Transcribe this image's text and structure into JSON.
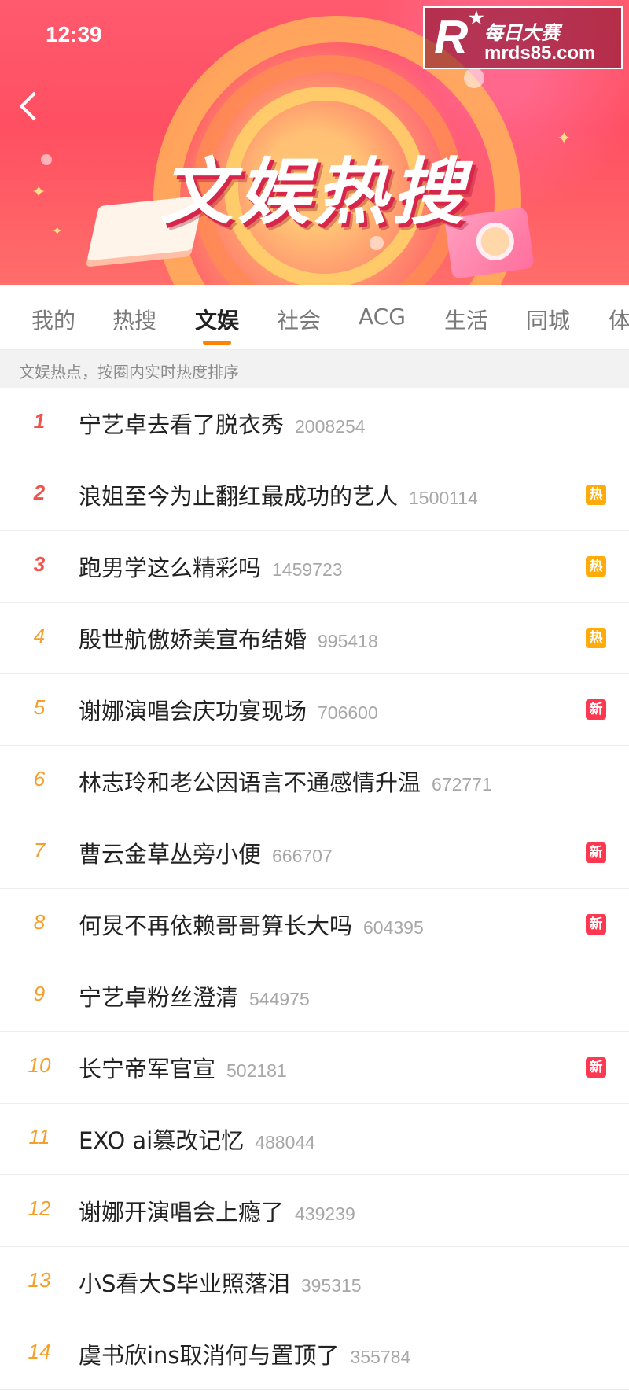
{
  "status_bar": {
    "time": "12:39"
  },
  "header": {
    "title": "文娱热搜"
  },
  "watermark": {
    "name": "每日大赛",
    "url": "mrds85.com",
    "logo_letter": "R"
  },
  "tabs": [
    {
      "label": "我的"
    },
    {
      "label": "热搜"
    },
    {
      "label": "文娱"
    },
    {
      "label": "社会"
    },
    {
      "label": "ACG"
    },
    {
      "label": "生活"
    },
    {
      "label": "同城"
    },
    {
      "label": "体"
    }
  ],
  "active_tab": "文娱",
  "subtitle": "文娱热点，按圈内实时热度排序",
  "badges": {
    "hot": "热",
    "new": "新"
  },
  "colors": {
    "accent": "#ff8200",
    "rank_top": "#f3524b",
    "rank_rest": "#f59f2a",
    "badge_hot": "#ffab0a",
    "badge_new": "#ff3852"
  },
  "list": [
    {
      "rank": "1",
      "title": "宁艺卓去看了脱衣秀",
      "heat": "2008254",
      "badge": ""
    },
    {
      "rank": "2",
      "title": "浪姐至今为止翻红最成功的艺人",
      "heat": "1500114",
      "badge": "热"
    },
    {
      "rank": "3",
      "title": "跑男学这么精彩吗",
      "heat": "1459723",
      "badge": "热"
    },
    {
      "rank": "4",
      "title": "殷世航傲娇美宣布结婚",
      "heat": "995418",
      "badge": "热"
    },
    {
      "rank": "5",
      "title": "谢娜演唱会庆功宴现场",
      "heat": "706600",
      "badge": "新"
    },
    {
      "rank": "6",
      "title": "林志玲和老公因语言不通感情升温",
      "heat": "672771",
      "badge": ""
    },
    {
      "rank": "7",
      "title": "曹云金草丛旁小便",
      "heat": "666707",
      "badge": "新"
    },
    {
      "rank": "8",
      "title": "何炅不再依赖哥哥算长大吗",
      "heat": "604395",
      "badge": "新"
    },
    {
      "rank": "9",
      "title": "宁艺卓粉丝澄清",
      "heat": "544975",
      "badge": ""
    },
    {
      "rank": "10",
      "title": "长宁帝军官宣",
      "heat": "502181",
      "badge": "新"
    },
    {
      "rank": "11",
      "title": "EXO ai篡改记忆",
      "heat": "488044",
      "badge": ""
    },
    {
      "rank": "12",
      "title": "谢娜开演唱会上瘾了",
      "heat": "439239",
      "badge": ""
    },
    {
      "rank": "13",
      "title": "小S看大S毕业照落泪",
      "heat": "395315",
      "badge": ""
    },
    {
      "rank": "14",
      "title": "虞书欣ins取消何与置顶了",
      "heat": "355784",
      "badge": ""
    }
  ]
}
